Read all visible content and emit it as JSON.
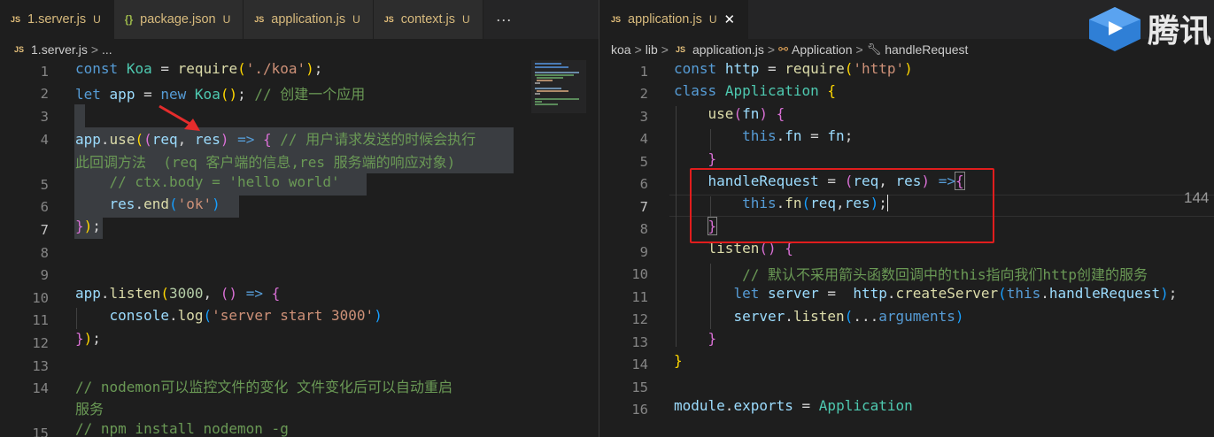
{
  "left": {
    "tabs": [
      {
        "label": "1.server.js",
        "icon": "JS",
        "mod": "U",
        "active": true
      },
      {
        "label": "package.json",
        "icon": "{}",
        "mod": "U",
        "active": false
      },
      {
        "label": "application.js",
        "icon": "JS",
        "mod": "U",
        "active": false
      },
      {
        "label": "context.js",
        "icon": "JS",
        "mod": "U",
        "active": false
      }
    ],
    "more": "···",
    "breadcrumb": {
      "file": "1.server.js",
      "sep": ">",
      "rest": "..."
    },
    "line_numbers": [
      "1",
      "2",
      "3",
      "4",
      "",
      "5",
      "6",
      "7",
      "8",
      "9",
      "10",
      "11",
      "12",
      "13",
      "14",
      "",
      "15"
    ]
  },
  "right": {
    "tab": {
      "label": "application.js",
      "icon": "JS",
      "mod": "U",
      "close": "✕"
    },
    "breadcrumb": {
      "p1": "koa",
      "p2": "lib",
      "file": "application.js",
      "cls": "Application",
      "method": "handleRequest"
    },
    "line_numbers": [
      "1",
      "2",
      "3",
      "4",
      "5",
      "6",
      "7",
      "8",
      "9",
      "10",
      "11",
      "12",
      "13",
      "14",
      "15",
      "16"
    ],
    "side_number": "144"
  },
  "brand": {
    "text": "腾讯",
    "logo_color": "#2f7fd6"
  }
}
